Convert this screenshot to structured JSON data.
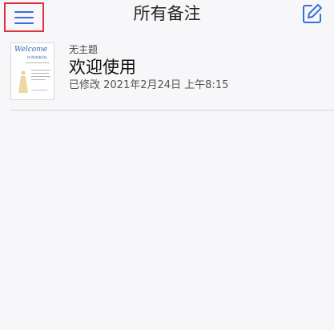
{
  "navbar": {
    "title": "所有备注",
    "menu_icon": "hamburger-menu-icon",
    "compose_icon": "compose-edit-icon",
    "accent_color": "#3a6fd8",
    "highlight_color": "#e0333d"
  },
  "notes": [
    {
      "folder": "无主题",
      "title": "欢迎使用",
      "modified": "已修改 2021年2月24日 上午8:15",
      "thumbnail": {
        "heading": "Welcome",
        "subheading": "to Notability"
      }
    }
  ]
}
